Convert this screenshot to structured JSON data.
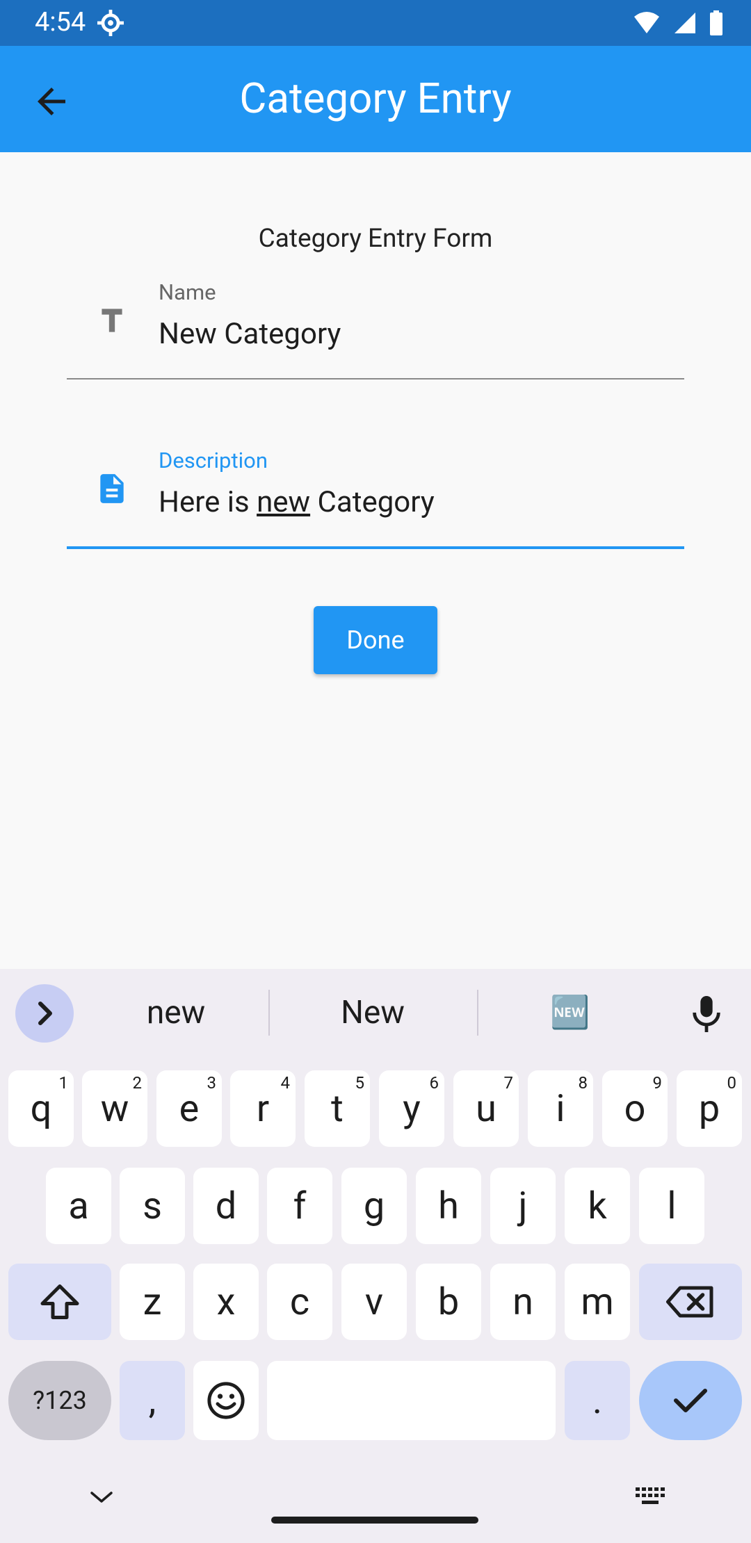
{
  "status_bar": {
    "time": "4:54"
  },
  "app_bar": {
    "title": "Category Entry"
  },
  "form": {
    "title": "Category Entry Form",
    "name_field": {
      "label": "Name",
      "value": "New Category"
    },
    "description_field": {
      "label": "Description",
      "value_prefix": "Here is ",
      "value_underlined": "new",
      "value_suffix": " Category"
    },
    "done_button": "Done"
  },
  "keyboard": {
    "suggestions": [
      "new",
      "New",
      "🆕"
    ],
    "row1": [
      {
        "k": "q",
        "n": "1"
      },
      {
        "k": "w",
        "n": "2"
      },
      {
        "k": "e",
        "n": "3"
      },
      {
        "k": "r",
        "n": "4"
      },
      {
        "k": "t",
        "n": "5"
      },
      {
        "k": "y",
        "n": "6"
      },
      {
        "k": "u",
        "n": "7"
      },
      {
        "k": "i",
        "n": "8"
      },
      {
        "k": "o",
        "n": "9"
      },
      {
        "k": "p",
        "n": "0"
      }
    ],
    "row2": [
      "a",
      "s",
      "d",
      "f",
      "g",
      "h",
      "j",
      "k",
      "l"
    ],
    "row3": [
      "z",
      "x",
      "c",
      "v",
      "b",
      "n",
      "m"
    ],
    "symbols_key": "?123",
    "comma_key": ",",
    "period_key": "."
  },
  "colors": {
    "primary": "#2196f3",
    "status_bar": "#1c6fbf",
    "keyboard_bg": "#f0edf3",
    "modifier_key": "#dcdff7"
  }
}
